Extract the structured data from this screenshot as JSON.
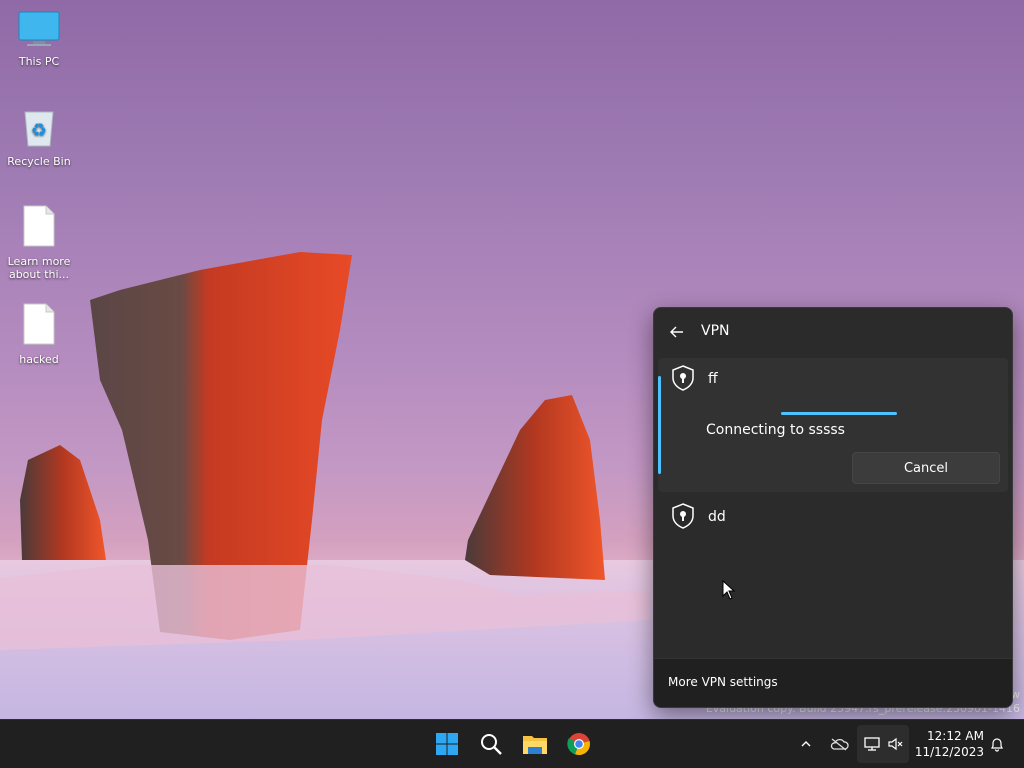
{
  "desktop": {
    "icons": [
      {
        "label": "This PC"
      },
      {
        "label": "Recycle Bin"
      },
      {
        "label": "Learn more about thi..."
      },
      {
        "label": "hacked"
      }
    ]
  },
  "vpn_flyout": {
    "title": "VPN",
    "connections": [
      {
        "name": "ff",
        "status": "Connecting to sssss",
        "action_label": "Cancel",
        "connecting": true
      },
      {
        "name": "dd"
      }
    ],
    "footer_link": "More VPN settings"
  },
  "watermark": {
    "line1": "w",
    "line2": "Evaluation copy. Build 25947.rs_prerelease.230901-1416"
  },
  "taskbar": {
    "apps": [
      "start-icon",
      "search-icon",
      "file-explorer-icon",
      "chrome-icon"
    ],
    "tray_icons": [
      "chevron-up-icon",
      "onedrive-icon",
      "network-icon",
      "volume-muted-icon",
      "notification-bell-icon"
    ],
    "time": "12:12 AM",
    "date": "11/12/2023"
  },
  "colors": {
    "accent": "#4cc2ff",
    "flyout_bg": "#2b2b2b",
    "taskbar_bg": "#202020"
  }
}
